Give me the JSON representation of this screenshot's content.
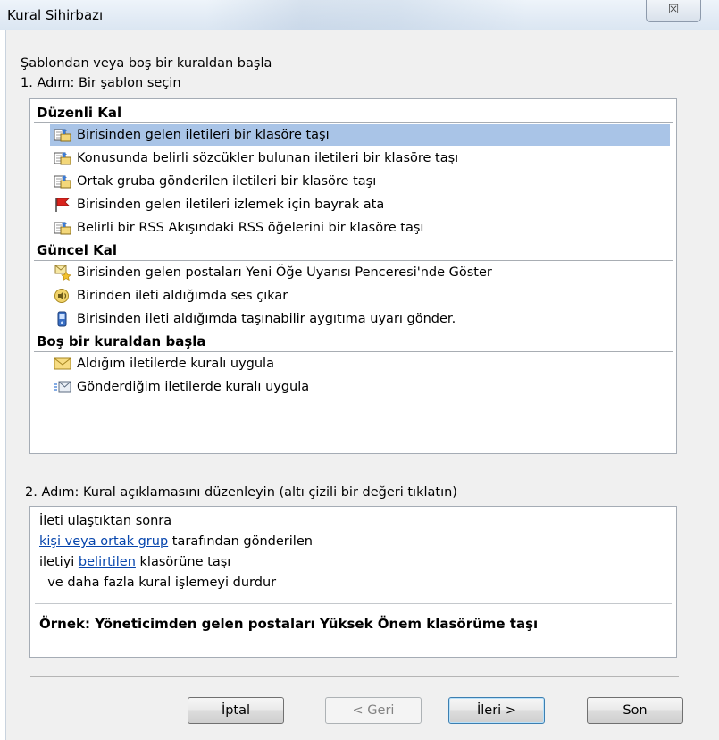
{
  "window": {
    "title": "Kural Sihirbazı",
    "close_glyph": "☒"
  },
  "header": {
    "start_label": "Şablondan veya boş bir kuraldan başla",
    "step1_label": "1. Adım: Bir şablon seçin"
  },
  "templates": {
    "categories": [
      {
        "title": "Düzenli Kal",
        "items": [
          {
            "icon": "move-to-folder-icon",
            "label": "Birisinden gelen iletileri bir klasöre taşı",
            "selected": true
          },
          {
            "icon": "move-to-folder-icon",
            "label": "Konusunda belirli sözcükler bulunan iletileri bir klasöre taşı"
          },
          {
            "icon": "move-to-folder-icon",
            "label": "Ortak gruba gönderilen iletileri bir klasöre taşı"
          },
          {
            "icon": "red-flag-icon",
            "label": "Birisinden gelen iletileri izlemek için bayrak ata"
          },
          {
            "icon": "move-to-folder-icon",
            "label": "Belirli bir RSS Akışındaki RSS öğelerini bir klasöre taşı"
          }
        ]
      },
      {
        "title": "Güncel Kal",
        "items": [
          {
            "icon": "new-item-alert-icon",
            "label": "Birisinden gelen postaları Yeni Öğe Uyarısı Penceresi'nde Göster"
          },
          {
            "icon": "speaker-icon",
            "label": "Birinden ileti aldığımda ses çıkar"
          },
          {
            "icon": "mobile-device-icon",
            "label": "Birisinden ileti aldığımda taşınabilir aygıtıma uyarı gönder."
          }
        ]
      },
      {
        "title": "Boş bir kuraldan başla",
        "items": [
          {
            "icon": "envelope-icon",
            "label": "Aldığım iletilerde kuralı uygula"
          },
          {
            "icon": "sent-mail-icon",
            "label": "Gönderdiğim iletilerde kuralı uygula"
          }
        ]
      }
    ]
  },
  "step2": {
    "label": "2. Adım: Kural açıklamasını düzenleyin (altı çizili bir değeri tıklatın)",
    "line1": "İleti ulaştıktan sonra",
    "line2_link": "kişi veya ortak grup",
    "line2_rest": " tarafından gönderilen",
    "line3_prefix": "iletiyi ",
    "line3_link": "belirtilen",
    "line3_rest": " klasörüne taşı",
    "line4": "  ve daha fazla kural işlemeyi durdur",
    "example": "Örnek: Yöneticimden gelen postaları Yüksek Önem klasörüme taşı"
  },
  "buttons": {
    "cancel": "İptal",
    "back": "< Geri",
    "next": "İleri >",
    "finish": "Son"
  }
}
